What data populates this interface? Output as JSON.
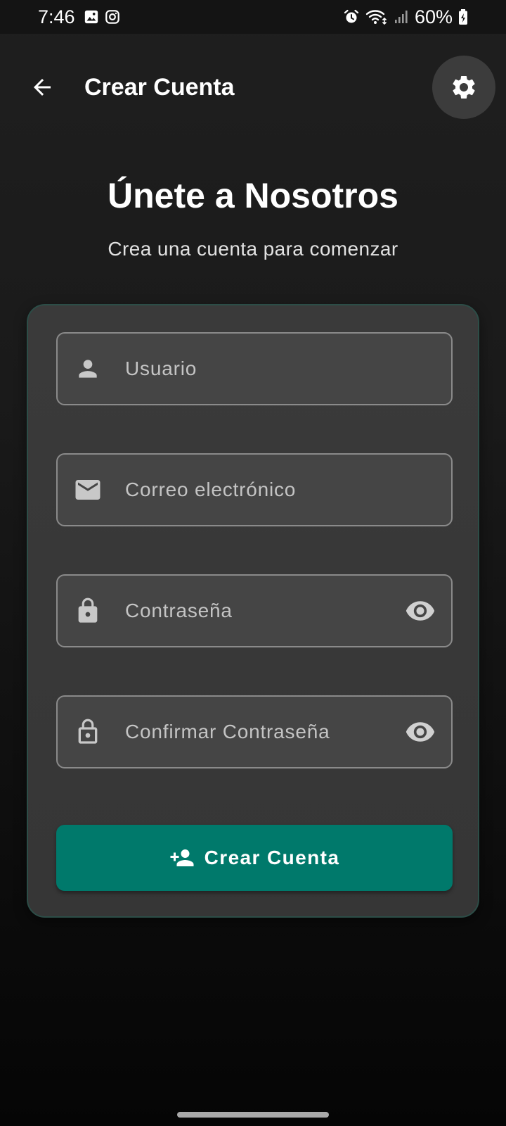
{
  "status_bar": {
    "time": "7:46",
    "battery": "60%",
    "left_icons": [
      "gallery-icon",
      "instagram-icon"
    ],
    "right_icons": [
      "alarm-icon",
      "wifi-icon",
      "signal-icon",
      "battery-icon"
    ]
  },
  "app_bar": {
    "title": "Crear Cuenta",
    "back_icon": "arrow-back-icon",
    "settings_icon": "gear-icon"
  },
  "header": {
    "title": "Únete a Nosotros",
    "subtitle": "Crea una cuenta para comenzar"
  },
  "form": {
    "username": {
      "placeholder": "Usuario",
      "value": "",
      "icon": "person-icon"
    },
    "email": {
      "placeholder": "Correo electrónico",
      "value": "",
      "icon": "mail-icon"
    },
    "password": {
      "placeholder": "Contraseña",
      "value": "",
      "icon": "lock-icon",
      "toggle_icon": "eye-icon"
    },
    "confirm_password": {
      "placeholder": "Confirmar Contraseña",
      "value": "",
      "icon": "lock-outline-icon",
      "toggle_icon": "eye-icon"
    },
    "submit_label": "Crear Cuenta",
    "submit_icon": "person-add-icon"
  },
  "colors": {
    "accent": "#00796b",
    "card_border": "#2c4d47",
    "field_border": "#8a8a8a",
    "background": "#1a1a1a"
  }
}
